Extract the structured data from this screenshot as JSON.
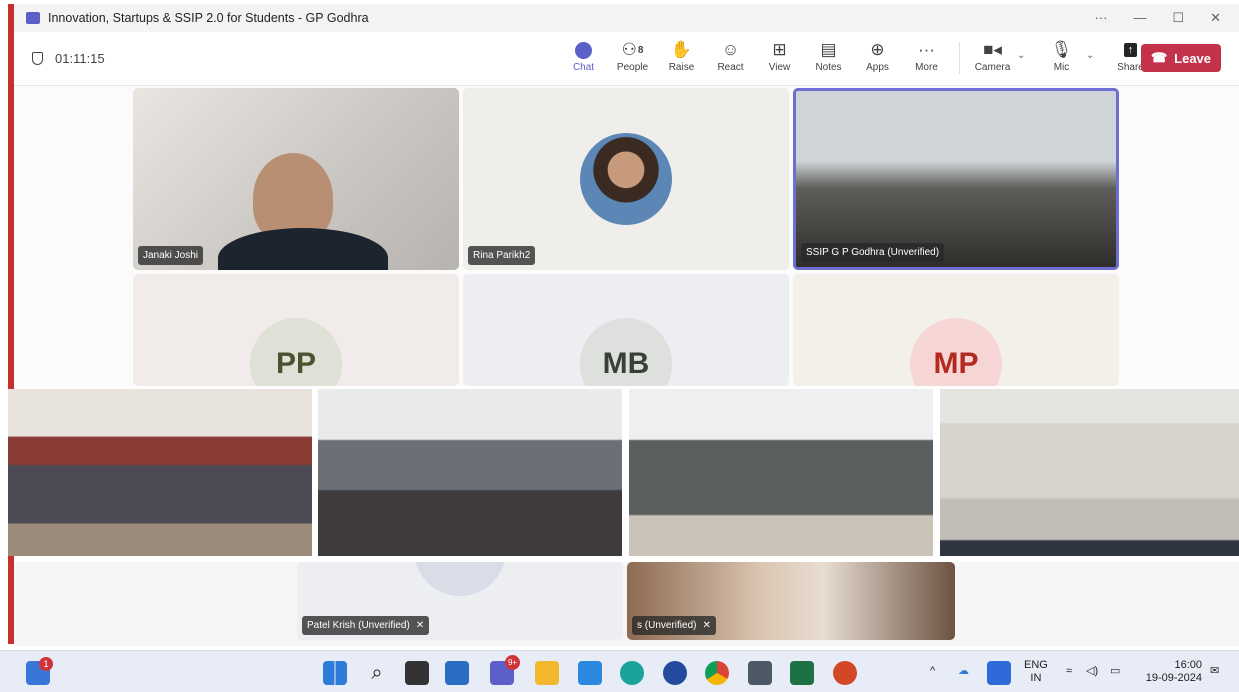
{
  "window": {
    "title": "Innovation, Startups & SSIP 2.0 for Students - GP Godhra",
    "controls": [
      "···",
      "—",
      "☐",
      "✕"
    ]
  },
  "meeting": {
    "timer": "01:11:15",
    "tools": [
      {
        "label": "Chat",
        "icon": "chat-icon",
        "active": true
      },
      {
        "label": "People",
        "icon": "people-icon",
        "count": "8"
      },
      {
        "label": "Raise",
        "icon": "hand-icon"
      },
      {
        "label": "React",
        "icon": "smiley-icon"
      },
      {
        "label": "View",
        "icon": "grid-icon"
      },
      {
        "label": "Notes",
        "icon": "notes-icon"
      },
      {
        "label": "Apps",
        "icon": "plus-icon"
      },
      {
        "label": "More",
        "icon": "more-icon"
      },
      {
        "label": "Camera",
        "icon": "camera-icon"
      },
      {
        "label": "Mic",
        "icon": "mic-icon"
      },
      {
        "label": "Share",
        "icon": "share-icon"
      }
    ],
    "leave_label": "Leave",
    "accent": "#5b5fc7",
    "leave_color": "#c4314b"
  },
  "participants": [
    {
      "name": "Janaki Joshi"
    },
    {
      "name": "Rina Parikh2"
    },
    {
      "name": "SSIP G P Godhra (Unverified)"
    },
    {
      "initials": "PP"
    },
    {
      "initials": "MB"
    },
    {
      "initials": "MP"
    },
    {
      "name": "Patel Krish (Unverified)"
    },
    {
      "name": "s (Unverified)"
    }
  ],
  "taskbar": {
    "badge_count": "1",
    "teams_badge": "9+",
    "tray": {
      "lang": "ENG",
      "region": "IN",
      "time": "16:00",
      "date": "19-09-2024"
    }
  }
}
